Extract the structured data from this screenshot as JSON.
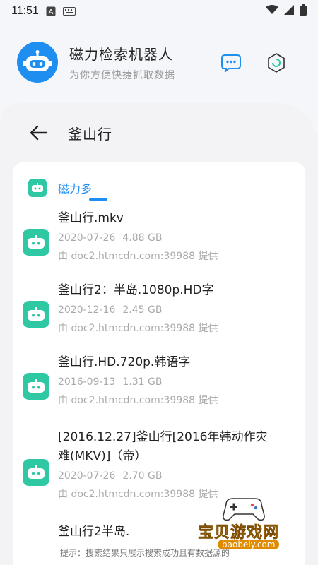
{
  "status_bar": {
    "time": "11:51",
    "icons": [
      "a-box-icon",
      "keyboard-icon",
      "wifi-icon",
      "signal-icon",
      "battery-icon"
    ]
  },
  "header": {
    "title": "磁力检索机器人",
    "subtitle": "为你方便快捷抓取数据",
    "buttons": [
      "more-dots-icon",
      "target-icon"
    ]
  },
  "search": {
    "query": "釜山行"
  },
  "tabs": [
    {
      "label": "磁力多",
      "active": true
    }
  ],
  "results": [
    {
      "title_lines": [
        "釜山行.mkv"
      ],
      "date": "2020-07-26",
      "size": "4.88 GB",
      "source": "由 doc2.htmcdn.com:39988 提供"
    },
    {
      "title_lines": [
        "釜山行2：半岛.1080p.HD字"
      ],
      "date": "2020-12-16",
      "size": "2.45 GB",
      "source": "由 doc2.htmcdn.com:39988 提供"
    },
    {
      "title_lines": [
        "釜山行.HD.720p.韩语字"
      ],
      "date": "2016-09-13",
      "size": "1.31 GB",
      "source": "由 doc2.htmcdn.com:39988 提供"
    },
    {
      "title_lines": [
        "[2016.12.27]釜山行[2016年韩动作灾",
        "难(MKV)]（帝）"
      ],
      "date": "2020-07-26",
      "size": "2.70 GB",
      "source": "由 doc2.htmcdn.com:39988 提供"
    },
    {
      "title_lines": [
        "釜山行2半岛."
      ],
      "date": "",
      "size": "",
      "source": ""
    }
  ],
  "footer": {
    "hint": "提示：搜索结果只展示搜索成功且有数据源的"
  },
  "watermark": {
    "main": "宝贝游戏网",
    "sub": "baobeiy.com"
  },
  "colors": {
    "accent": "#1f8ef1",
    "robot_green": "#2ec8a2",
    "muted_text": "#aaaaaa"
  }
}
